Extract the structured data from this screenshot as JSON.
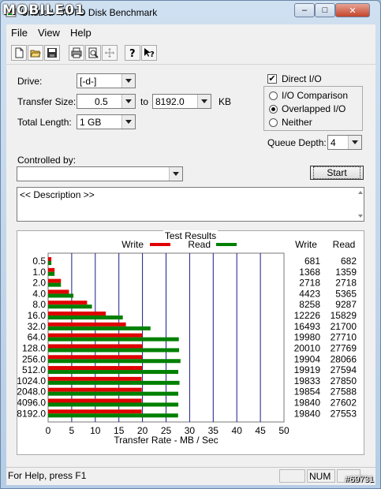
{
  "window": {
    "title": "Untitled - ATTO Disk Benchmark",
    "watermark": "MOBILE01",
    "buttons": {
      "minimize": "–",
      "maximize": "□",
      "close": "✕"
    }
  },
  "menu": [
    "File",
    "View",
    "Help"
  ],
  "toolbar": [
    "new-icon",
    "open-icon",
    "save-icon",
    "print-icon",
    "print-preview-icon",
    "move-icon",
    "help-icon",
    "context-help-icon"
  ],
  "form": {
    "drive_label": "Drive:",
    "drive_value": "[-d-]",
    "transfer_size_label": "Transfer Size:",
    "transfer_from": "0.5",
    "to_label": "to",
    "transfer_to": "8192.0",
    "kb_label": "KB",
    "total_length_label": "Total Length:",
    "total_length_value": "1 GB",
    "controlled_by_label": "Controlled by:",
    "controlled_by_value": "",
    "direct_io_label": "Direct I/O",
    "io_comparison_label": "I/O Comparison",
    "overlapped_io_label": "Overlapped I/O",
    "neither_label": "Neither",
    "queue_depth_label": "Queue Depth:",
    "queue_depth_value": "4",
    "start_label": "Start",
    "description": "<< Description >>"
  },
  "results_title": "Test Results",
  "chart_data": {
    "type": "bar",
    "orientation": "horizontal",
    "categories": [
      "0.5",
      "1.0",
      "2.0",
      "4.0",
      "8.0",
      "16.0",
      "32.0",
      "64.0",
      "128.0",
      "256.0",
      "512.0",
      "1024.0",
      "2048.0",
      "4096.0",
      "8192.0"
    ],
    "series": [
      {
        "name": "Write",
        "color": "#e00000",
        "values": [
          681,
          1368,
          2718,
          4423,
          8258,
          12226,
          16493,
          19980,
          20010,
          19904,
          19919,
          19833,
          19854,
          19840,
          19840
        ]
      },
      {
        "name": "Read",
        "color": "#008000",
        "values": [
          682,
          1359,
          2718,
          5365,
          9287,
          15829,
          21700,
          27710,
          27769,
          28066,
          27594,
          27850,
          27588,
          27602,
          27553
        ]
      }
    ],
    "value_unit": "KB/s",
    "xlabel": "Transfer Rate - MB / Sec",
    "xlim": [
      0,
      50
    ],
    "xticks": [
      "0",
      "5",
      "10",
      "15",
      "20",
      "25",
      "30",
      "35",
      "40",
      "45",
      "50"
    ],
    "column_headers": [
      "Write",
      "Read"
    ],
    "legend_position": "top",
    "grid": true
  },
  "status": {
    "help_text": "For Help, press F1",
    "num": "NUM",
    "corner_text": "#69731"
  }
}
